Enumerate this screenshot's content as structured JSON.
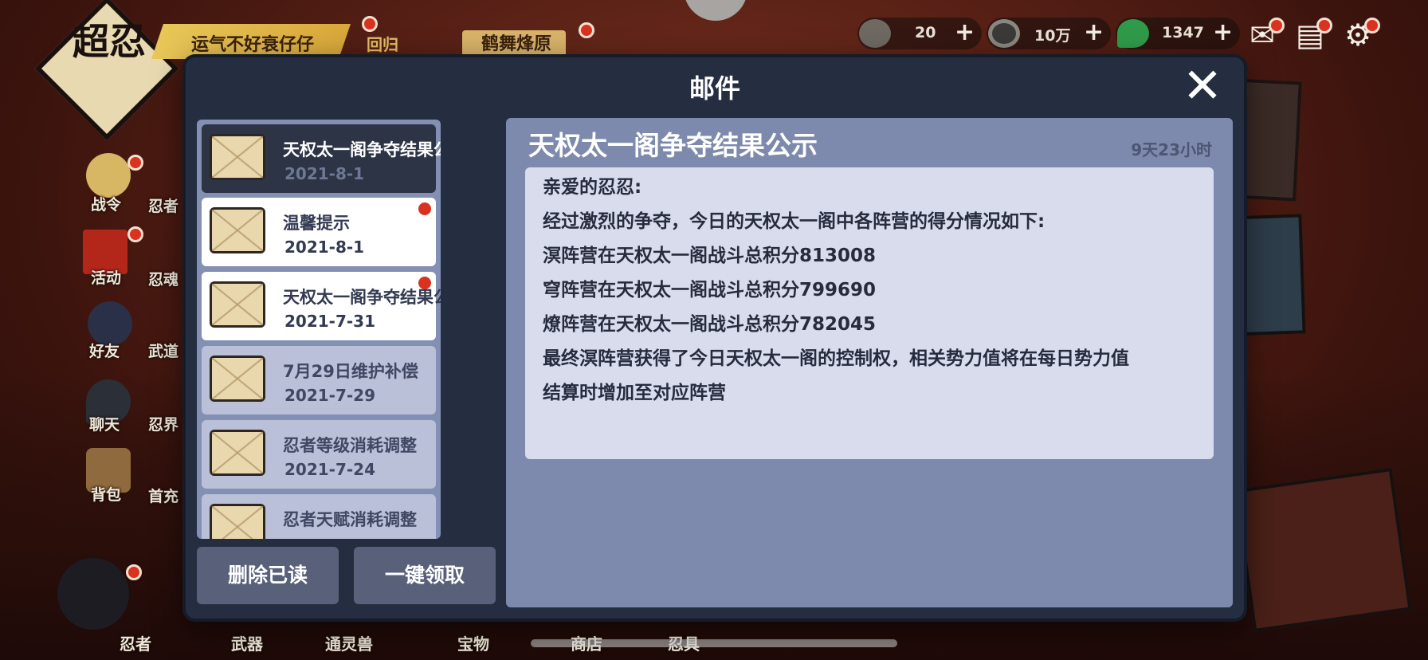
{
  "top_bar": {
    "logo_text": "超忍",
    "banner_text": "运气不好衰仔仔",
    "return_label": "回归",
    "stage_label": "鹤舞烽原",
    "resources": [
      {
        "icon": "rice-ball-icon",
        "value": "20"
      },
      {
        "icon": "coin-icon",
        "value": "10万"
      },
      {
        "icon": "jade-icon",
        "value": "1347"
      }
    ],
    "plus_symbol": "+"
  },
  "side_menu": [
    {
      "label": "战令",
      "icon": "scroll-icon"
    },
    {
      "label": "活动",
      "icon": "torii-icon"
    },
    {
      "label": "好友",
      "icon": "ninja-head-icon"
    },
    {
      "label": "聊天",
      "icon": "chat-bubble-icon"
    },
    {
      "label": "背包",
      "icon": "bag-icon"
    }
  ],
  "side_menu_2": [
    {
      "label": "忍者"
    },
    {
      "label": "忍魂"
    },
    {
      "label": "武道"
    },
    {
      "label": "忍界"
    },
    {
      "label": "首充"
    }
  ],
  "bottom_nav": [
    {
      "label": "忍者"
    },
    {
      "label": "武器"
    },
    {
      "label": "通灵兽"
    },
    {
      "label": "宝物"
    },
    {
      "label": "商店"
    },
    {
      "label": "忍具"
    }
  ],
  "modal": {
    "title": "邮件",
    "close_symbol": "✕",
    "mail_list": [
      {
        "title": "天权太一阁争夺结果公示",
        "date": "2021-8-1",
        "state": "selected",
        "unread_dot": false
      },
      {
        "title": "温馨提示",
        "date": "2021-8-1",
        "state": "unread",
        "unread_dot": true
      },
      {
        "title": "天权太一阁争夺结果公示",
        "date": "2021-7-31",
        "state": "unread",
        "unread_dot": true
      },
      {
        "title": "7月29日维护补偿",
        "date": "2021-7-29",
        "state": "read",
        "unread_dot": false
      },
      {
        "title": "忍者等级消耗调整",
        "date": "2021-7-24",
        "state": "read",
        "unread_dot": false
      },
      {
        "title": "忍者天赋消耗调整",
        "date": "",
        "state": "read",
        "unread_dot": false
      }
    ],
    "buttons": {
      "delete_read": "删除已读",
      "claim_all": "一键领取"
    },
    "detail": {
      "title": "天权太一阁争夺结果公示",
      "expire": "9天23小时",
      "lines": [
        "亲爱的忍忍:",
        "经过激烈的争夺，今日的天权太一阁中各阵营的得分情况如下:",
        "溟阵营在天权太一阁战斗总积分813008",
        "穹阵营在天权太一阁战斗总积分799690",
        "燎阵营在天权太一阁战斗总积分782045",
        "最终溟阵营获得了今日天权太一阁的控制权，相关势力值将在每日势力值",
        "结算时增加至对应阵营"
      ]
    }
  }
}
